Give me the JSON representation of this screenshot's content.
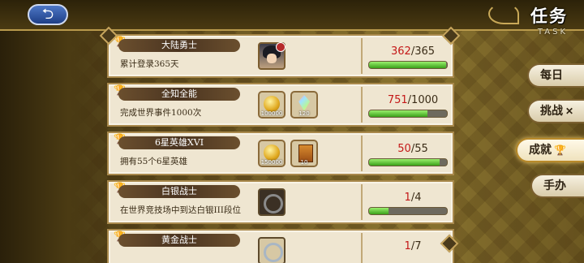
{
  "header": {
    "back_glyph": "⮌",
    "title": "任务",
    "subtitle": "TASK"
  },
  "tabs": [
    {
      "label": "每日",
      "glyph": "",
      "active": false
    },
    {
      "label": "挑战",
      "glyph": "✕",
      "active": false
    },
    {
      "label": "成就",
      "glyph": "🏆",
      "active": true
    },
    {
      "label": "手办",
      "glyph": "",
      "active": false
    }
  ],
  "achievements": [
    {
      "title": "大陆勇士",
      "desc": "累计登录365天",
      "progress_current": "362",
      "progress_total": "/365",
      "progress_fraction": 0.99,
      "rewards": [
        {
          "type": "portrait-icon",
          "qty": ""
        }
      ]
    },
    {
      "title": "全知全能",
      "desc": "完成世界事件1000次",
      "progress_current": "751",
      "progress_total": "/1000",
      "progress_fraction": 0.751,
      "rewards": [
        {
          "type": "gold-coin-icon",
          "qty": "100000"
        },
        {
          "type": "rainbow-gem-icon",
          "qty": "120"
        }
      ]
    },
    {
      "title": "6星英雄XVI",
      "desc": "拥有55个6星英雄",
      "progress_current": "50",
      "progress_total": "/55",
      "progress_fraction": 0.909,
      "rewards": [
        {
          "type": "gold-coin-icon",
          "qty": "150000"
        },
        {
          "type": "book-icon",
          "qty": "10"
        }
      ]
    },
    {
      "title": "白银战士",
      "desc": "在世界竞技场中到达白银III段位",
      "progress_current": "1",
      "progress_total": "/4",
      "progress_fraction": 0.25,
      "rewards": [
        {
          "type": "ring-icon",
          "qty": ""
        }
      ]
    },
    {
      "title": "黄金战士",
      "desc": "",
      "progress_current": "1",
      "progress_total": "/7",
      "progress_fraction": 0.143,
      "rewards": [
        {
          "type": "ring-icon",
          "qty": ""
        }
      ]
    }
  ],
  "colors": {
    "progress_current": "#c41818",
    "bar_fill": "#3aa019",
    "card_bg": "#efe6d1",
    "title_bar": "#4a3420"
  }
}
